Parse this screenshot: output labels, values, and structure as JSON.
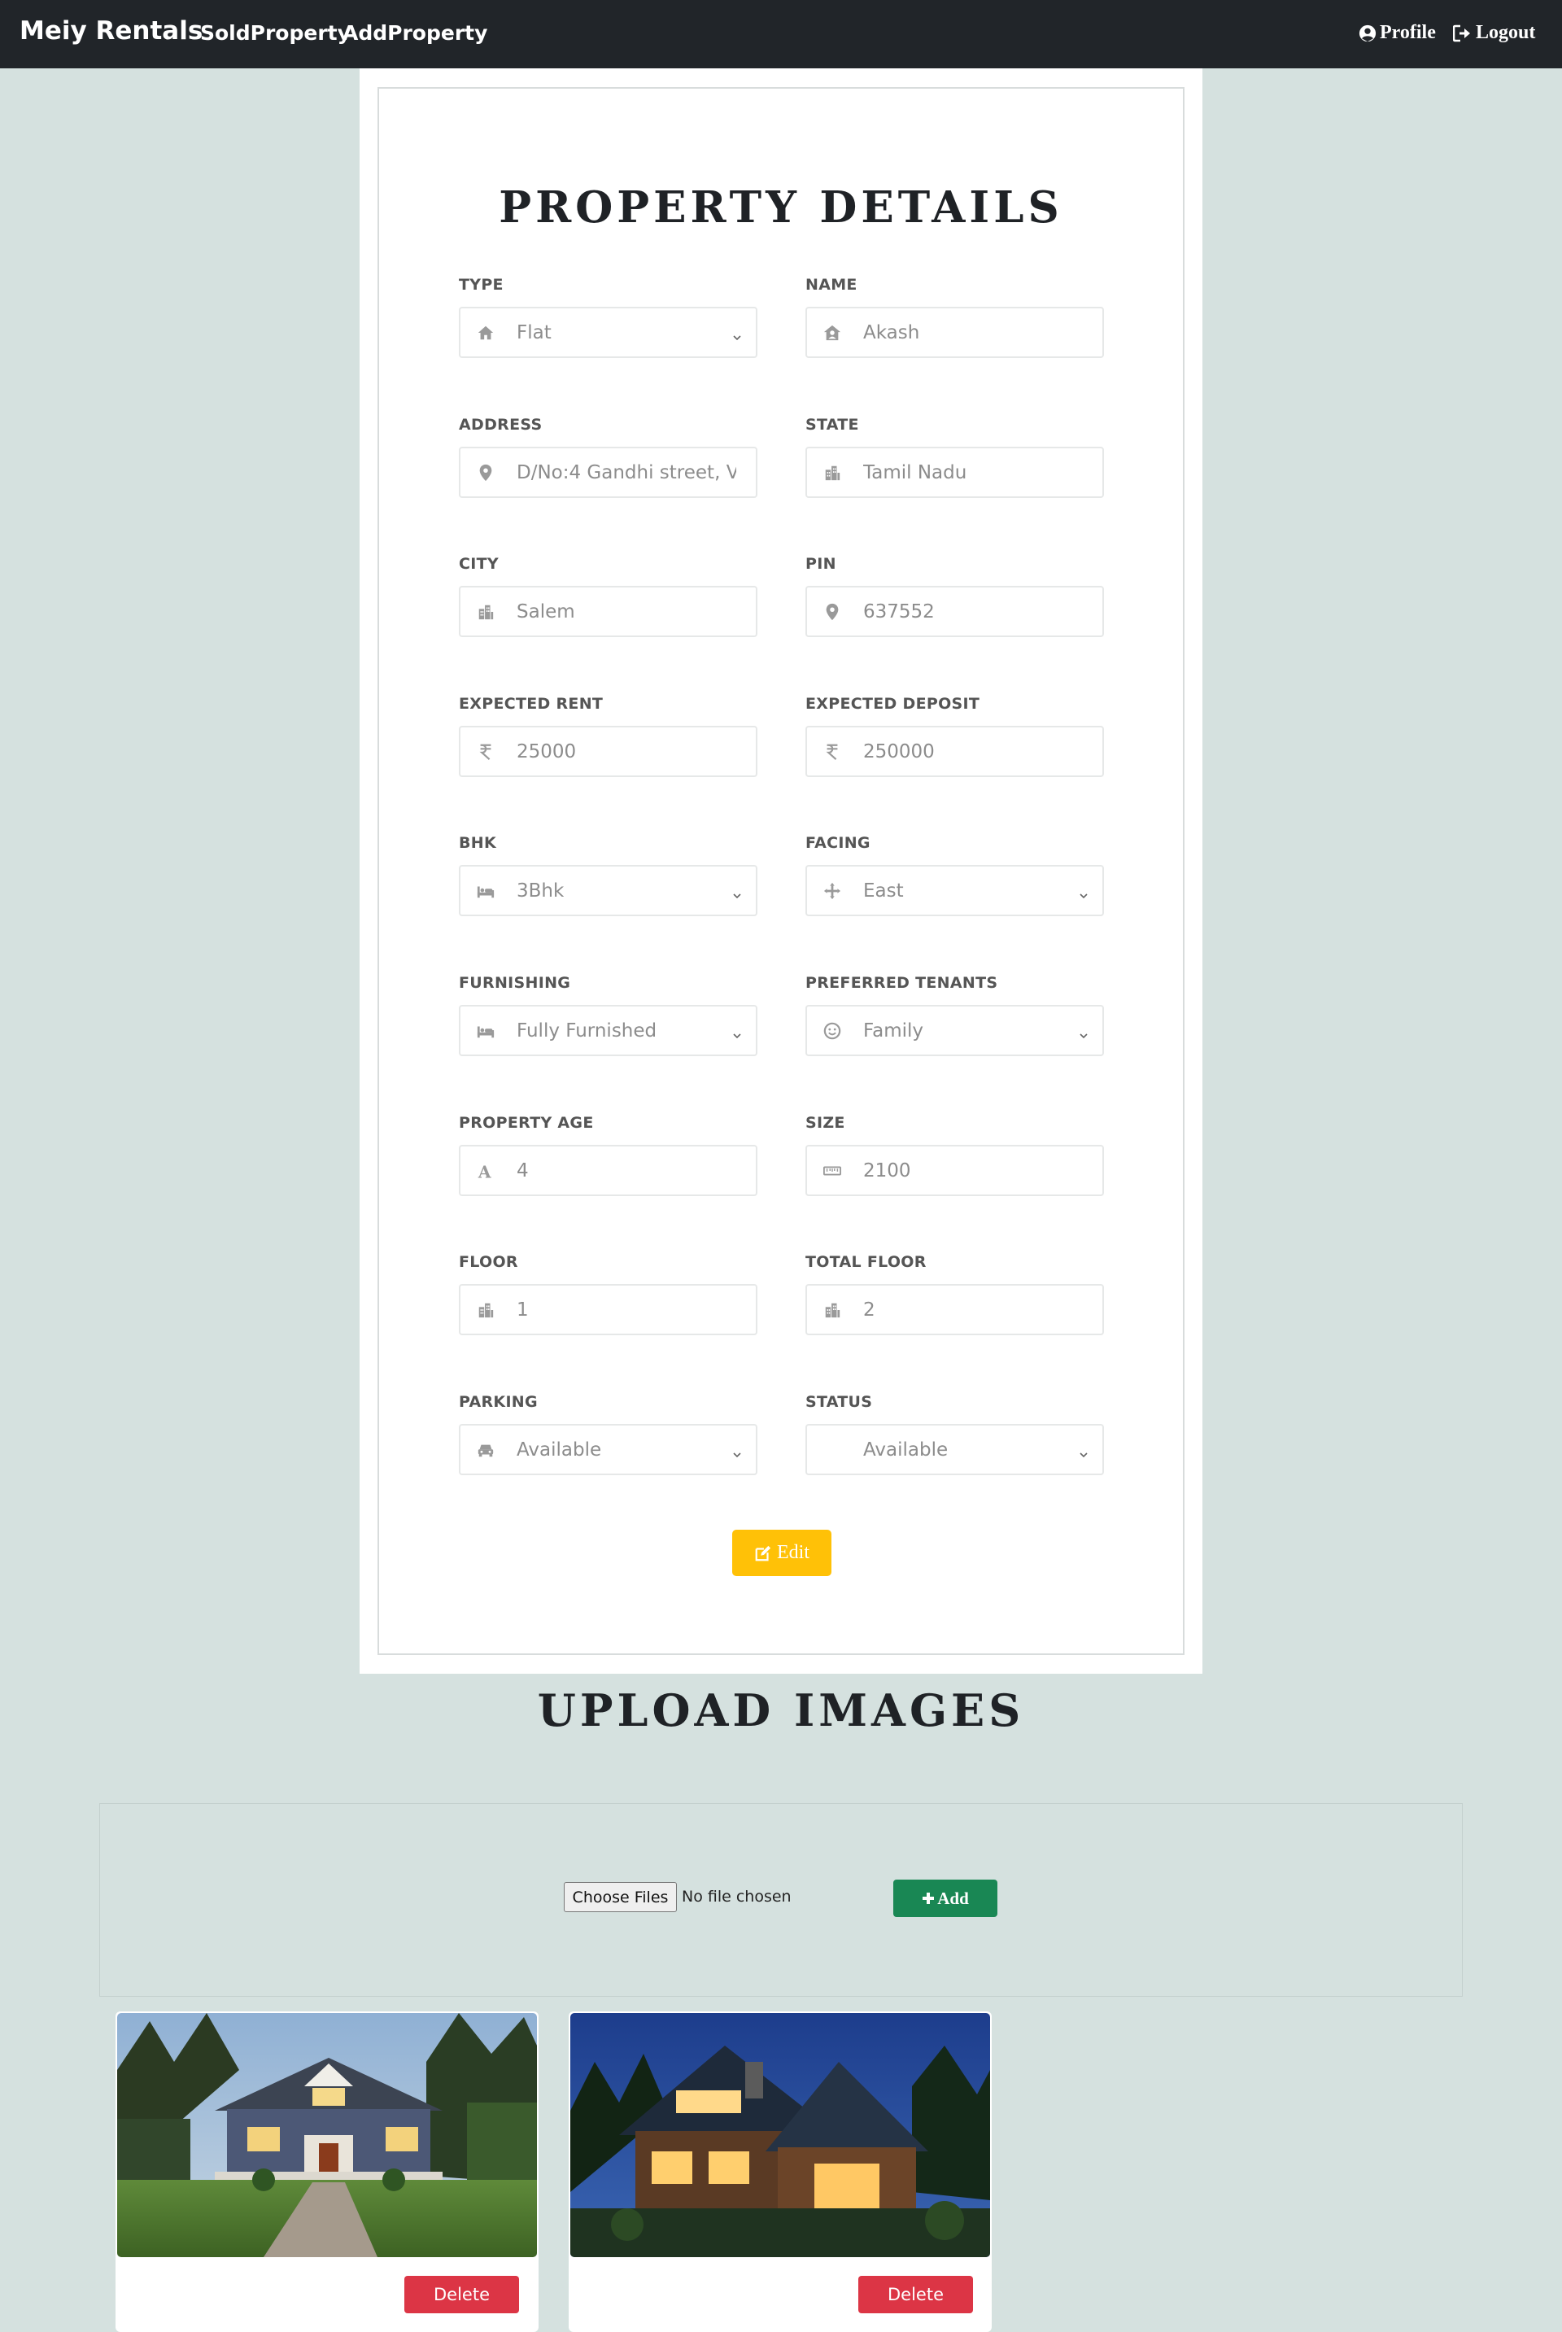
{
  "navbar": {
    "brand": "Meiy Rentals",
    "links": [
      "SoldProperty",
      "AddProperty"
    ],
    "profile": "Profile",
    "logout": "Logout"
  },
  "form": {
    "title": "PROPERTY DETAILS",
    "fields": {
      "type": {
        "label": "TYPE",
        "value": "Flat",
        "icon": "home-icon",
        "kind": "select"
      },
      "name": {
        "label": "NAME",
        "value": "Akash",
        "icon": "house-user-icon",
        "kind": "input"
      },
      "address": {
        "label": "ADDRESS",
        "value": "D/No:4 Gandhi street, Vell",
        "icon": "map-pin-icon",
        "kind": "input"
      },
      "state": {
        "label": "STATE",
        "value": "Tamil Nadu",
        "icon": "city-icon",
        "kind": "input"
      },
      "city": {
        "label": "CITY",
        "value": "Salem",
        "icon": "city-icon",
        "kind": "input"
      },
      "pin": {
        "label": "PIN",
        "value": "637552",
        "icon": "map-pin-icon",
        "kind": "input"
      },
      "expected_rent": {
        "label": "EXPECTED RENT",
        "value": "25000",
        "icon": "rupee-icon",
        "kind": "input"
      },
      "expected_deposit": {
        "label": "EXPECTED DEPOSIT",
        "value": "250000",
        "icon": "rupee-icon",
        "kind": "input"
      },
      "bhk": {
        "label": "BHK",
        "value": "3Bhk",
        "icon": "bed-icon",
        "kind": "select"
      },
      "facing": {
        "label": "FACING",
        "value": "East",
        "icon": "compass-arrows-icon",
        "kind": "select"
      },
      "furnishing": {
        "label": "FURNISHING",
        "value": "Fully Furnished",
        "icon": "bed-icon",
        "kind": "select"
      },
      "preferred_tenants": {
        "label": "PREFERRED TENANTS",
        "value": "Family",
        "icon": "smile-icon",
        "kind": "select"
      },
      "property_age": {
        "label": "PROPERTY AGE",
        "value": "4",
        "icon": "letter-a-icon",
        "kind": "input"
      },
      "size": {
        "label": "SIZE",
        "value": "2100",
        "icon": "ruler-icon",
        "kind": "input"
      },
      "floor": {
        "label": "FLOOR",
        "value": "1",
        "icon": "city-icon",
        "kind": "input"
      },
      "total_floor": {
        "label": "TOTAL FLOOR",
        "value": "2",
        "icon": "city-icon",
        "kind": "input"
      },
      "parking": {
        "label": "PARKING",
        "value": "Available",
        "icon": "car-icon",
        "kind": "select"
      },
      "status": {
        "label": "STATUS",
        "value": "Available",
        "icon": "",
        "kind": "select"
      }
    },
    "edit_label": "Edit"
  },
  "upload": {
    "title": "UPLOAD IMAGES",
    "choose_label": "Choose Files",
    "file_status": "No file chosen",
    "add_label": "Add"
  },
  "images": [
    {
      "delete_label": "Delete",
      "scene": "craftsman-house-dusk"
    },
    {
      "delete_label": "Delete",
      "scene": "modern-cabin-night"
    }
  ],
  "colors": {
    "page_bg": "#d5e1df",
    "navbar_bg": "#212529",
    "edit": "#ffc107",
    "add": "#198754",
    "delete": "#dc3545"
  }
}
